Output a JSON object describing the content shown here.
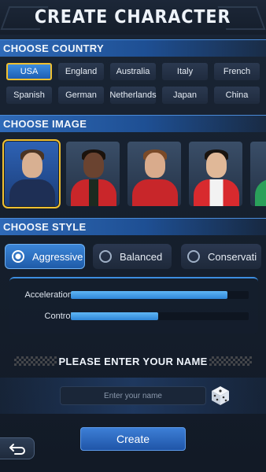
{
  "title": "CREATE CHARACTER",
  "sections": {
    "country": "CHOOSE COUNTRY",
    "image": "CHOOSE IMAGE",
    "style": "CHOOSE STYLE"
  },
  "countries": [
    "USA",
    "England",
    "Australia",
    "Italy",
    "French",
    "Spanish",
    "German",
    "Netherlands",
    "Japan",
    "China"
  ],
  "selected_country": "USA",
  "portraits": [
    {
      "name": "driver-1",
      "selected": true
    },
    {
      "name": "driver-2",
      "selected": false
    },
    {
      "name": "driver-3",
      "selected": false
    },
    {
      "name": "driver-4",
      "selected": false
    },
    {
      "name": "driver-5",
      "selected": false
    }
  ],
  "styles": [
    "Aggressive",
    "Balanced",
    "Conservati"
  ],
  "selected_style": "Aggressive",
  "stats": [
    {
      "label": "Acceleration",
      "value": 0.88
    },
    {
      "label": "Control",
      "value": 0.49
    }
  ],
  "name_prompt": "PLEASE ENTER YOUR NAME",
  "name_input": {
    "placeholder": "Enter your name",
    "value": ""
  },
  "create_label": "Create",
  "colors": {
    "accent": "#2f7ad0",
    "highlight": "#f0c030"
  }
}
